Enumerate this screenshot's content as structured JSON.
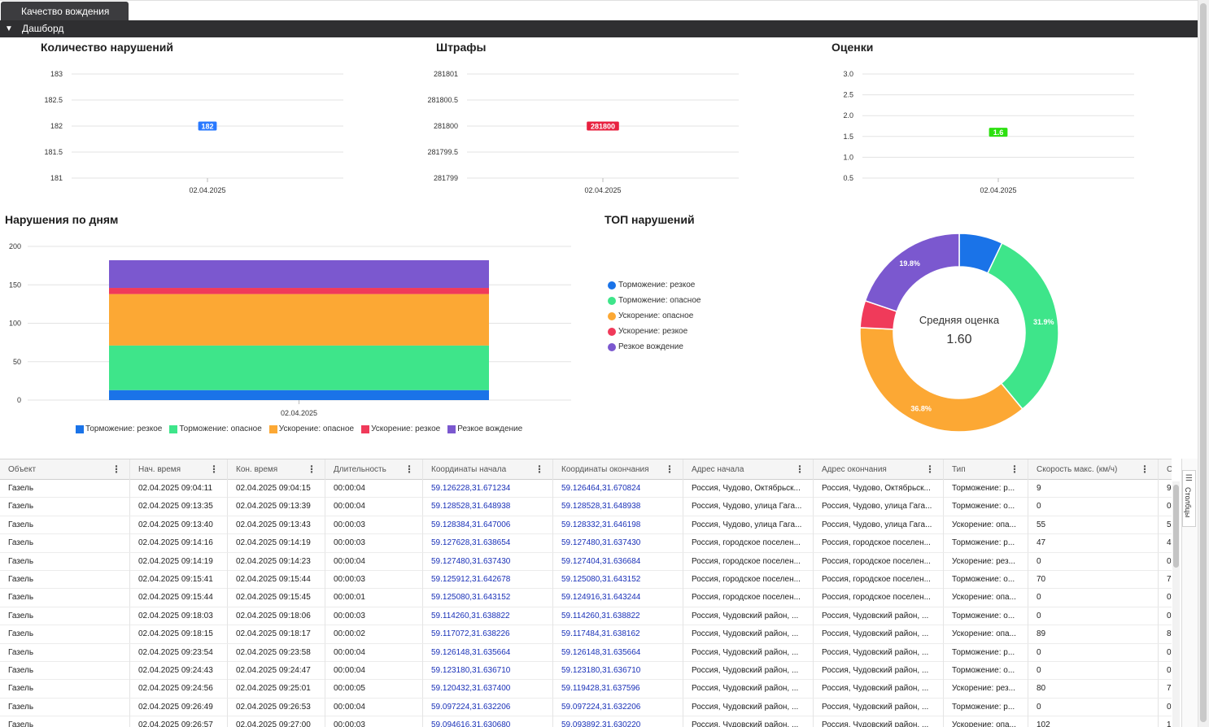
{
  "tab": {
    "label": "Качество вождения"
  },
  "section": {
    "label": "Дашборд",
    "toggle": "▼"
  },
  "violations_count": {
    "title": "Количество нарушений",
    "color": "#2979ff",
    "chart_data": {
      "type": "line",
      "x": [
        "02.04.2025"
      ],
      "values": [
        182
      ],
      "yticks": [
        "183",
        "182.5",
        "182",
        "181.5",
        "181"
      ],
      "ylim": [
        181,
        183
      ],
      "point_label": "182"
    }
  },
  "fines": {
    "title": "Штрафы",
    "color": "#e8203f",
    "chart_data": {
      "type": "line",
      "x": [
        "02.04.2025"
      ],
      "values": [
        281800
      ],
      "yticks": [
        "281801",
        "281800.5",
        "281800",
        "281799.5",
        "281799"
      ],
      "ylim": [
        281799,
        281801
      ],
      "point_label": "281800"
    }
  },
  "ratings": {
    "title": "Оценки",
    "color": "#2ce00f",
    "chart_data": {
      "type": "line",
      "x": [
        "02.04.2025"
      ],
      "values": [
        1.6
      ],
      "yticks": [
        "3.0",
        "2.5",
        "2.0",
        "1.5",
        "1.0",
        "0.5"
      ],
      "ylim": [
        0.5,
        3.0
      ],
      "point_label": "1.6"
    }
  },
  "by_day": {
    "title": "Нарушения по дням",
    "chart_data": {
      "type": "bar",
      "stacked": true,
      "categories": [
        "02.04.2025"
      ],
      "yticks": [
        "200",
        "150",
        "100",
        "50",
        "0"
      ],
      "ylim": [
        0,
        200
      ],
      "series": [
        {
          "name": "Торможение: резкое",
          "color": "#1a73e8",
          "values": [
            13
          ]
        },
        {
          "name": "Торможение: опасное",
          "color": "#3ee58a",
          "values": [
            58
          ]
        },
        {
          "name": "Ускорение: опасное",
          "color": "#fca834",
          "values": [
            67
          ]
        },
        {
          "name": "Ускорение: резкое",
          "color": "#f03a5a",
          "values": [
            8
          ]
        },
        {
          "name": "Резкое вождение",
          "color": "#7b58cf",
          "values": [
            36
          ]
        }
      ]
    }
  },
  "top": {
    "title": "ТОП нарушений",
    "center_title": "Средняя оценка",
    "center_value": "1.60",
    "chart_data": {
      "type": "pie",
      "labels": [
        "Торможение: резкое",
        "Торможение: опасное",
        "Ускорение: опасное",
        "Ускорение: резкое",
        "Резкое вождение"
      ],
      "colors": [
        "#1a73e8",
        "#3ee58a",
        "#fca834",
        "#f03a5a",
        "#7b58cf"
      ],
      "values": [
        7.1,
        31.9,
        36.8,
        4.4,
        19.8
      ],
      "slice_labels": [
        "",
        "31.9%",
        "36.8%",
        "",
        "19.8%"
      ]
    }
  },
  "table": {
    "columns": [
      "Объект",
      "Нач. время",
      "Кон. время",
      "Длительность",
      "Координаты начала",
      "Координаты окончания",
      "Адрес начала",
      "Адрес окончания",
      "Тип",
      "Скорость макс. (км/ч)",
      "Ско"
    ],
    "rows": [
      [
        "Газель",
        "02.04.2025 09:04:11",
        "02.04.2025 09:04:15",
        "00:00:04",
        "59.126228,31.671234",
        "59.126464,31.670824",
        "Россия, Чудово, Октябрьск...",
        "Россия, Чудово, Октябрьск...",
        "Торможение: р...",
        "9",
        "9"
      ],
      [
        "Газель",
        "02.04.2025 09:13:35",
        "02.04.2025 09:13:39",
        "00:00:04",
        "59.128528,31.648938",
        "59.128528,31.648938",
        "Россия, Чудово, улица Гага...",
        "Россия, Чудово, улица Гага...",
        "Торможение: о...",
        "0",
        "0"
      ],
      [
        "Газель",
        "02.04.2025 09:13:40",
        "02.04.2025 09:13:43",
        "00:00:03",
        "59.128384,31.647006",
        "59.128332,31.646198",
        "Россия, Чудово, улица Гага...",
        "Россия, Чудово, улица Гага...",
        "Ускорение: опа...",
        "55",
        "5"
      ],
      [
        "Газель",
        "02.04.2025 09:14:16",
        "02.04.2025 09:14:19",
        "00:00:03",
        "59.127628,31.638654",
        "59.127480,31.637430",
        "Россия, городское поселен...",
        "Россия, городское поселен...",
        "Торможение: р...",
        "47",
        "4"
      ],
      [
        "Газель",
        "02.04.2025 09:14:19",
        "02.04.2025 09:14:23",
        "00:00:04",
        "59.127480,31.637430",
        "59.127404,31.636684",
        "Россия, городское поселен...",
        "Россия, городское поселен...",
        "Ускорение: рез...",
        "0",
        "0"
      ],
      [
        "Газель",
        "02.04.2025 09:15:41",
        "02.04.2025 09:15:44",
        "00:00:03",
        "59.125912,31.642678",
        "59.125080,31.643152",
        "Россия, городское поселен...",
        "Россия, городское поселен...",
        "Торможение: о...",
        "70",
        "7"
      ],
      [
        "Газель",
        "02.04.2025 09:15:44",
        "02.04.2025 09:15:45",
        "00:00:01",
        "59.125080,31.643152",
        "59.124916,31.643244",
        "Россия, городское поселен...",
        "Россия, городское поселен...",
        "Ускорение: опа...",
        "0",
        "0"
      ],
      [
        "Газель",
        "02.04.2025 09:18:03",
        "02.04.2025 09:18:06",
        "00:00:03",
        "59.114260,31.638822",
        "59.114260,31.638822",
        "Россия, Чудовский район, ...",
        "Россия, Чудовский район, ...",
        "Торможение: о...",
        "0",
        "0"
      ],
      [
        "Газель",
        "02.04.2025 09:18:15",
        "02.04.2025 09:18:17",
        "00:00:02",
        "59.117072,31.638226",
        "59.117484,31.638162",
        "Россия, Чудовский район, ...",
        "Россия, Чудовский район, ...",
        "Ускорение: опа...",
        "89",
        "8"
      ],
      [
        "Газель",
        "02.04.2025 09:23:54",
        "02.04.2025 09:23:58",
        "00:00:04",
        "59.126148,31.635664",
        "59.126148,31.635664",
        "Россия, Чудовский район, ...",
        "Россия, Чудовский район, ...",
        "Торможение: р...",
        "0",
        "0"
      ],
      [
        "Газель",
        "02.04.2025 09:24:43",
        "02.04.2025 09:24:47",
        "00:00:04",
        "59.123180,31.636710",
        "59.123180,31.636710",
        "Россия, Чудовский район, ...",
        "Россия, Чудовский район, ...",
        "Торможение: о...",
        "0",
        "0"
      ],
      [
        "Газель",
        "02.04.2025 09:24:56",
        "02.04.2025 09:25:01",
        "00:00:05",
        "59.120432,31.637400",
        "59.119428,31.637596",
        "Россия, Чудовский район, ...",
        "Россия, Чудовский район, ...",
        "Ускорение: рез...",
        "80",
        "7"
      ],
      [
        "Газель",
        "02.04.2025 09:26:49",
        "02.04.2025 09:26:53",
        "00:00:04",
        "59.097224,31.632206",
        "59.097224,31.632206",
        "Россия, Чудовский район, ...",
        "Россия, Чудовский район, ...",
        "Торможение: р...",
        "0",
        "0"
      ],
      [
        "Газель",
        "02.04.2025 09:26:57",
        "02.04.2025 09:27:00",
        "00:00:03",
        "59.094616,31.630680",
        "59.093892,31.630220",
        "Россия, Чудовский район, ...",
        "Россия, Чудовский район, ...",
        "Ускорение: опа...",
        "102",
        "1"
      ]
    ],
    "columns_button": "Столбцы",
    "columns_icon": "columns-icon"
  }
}
